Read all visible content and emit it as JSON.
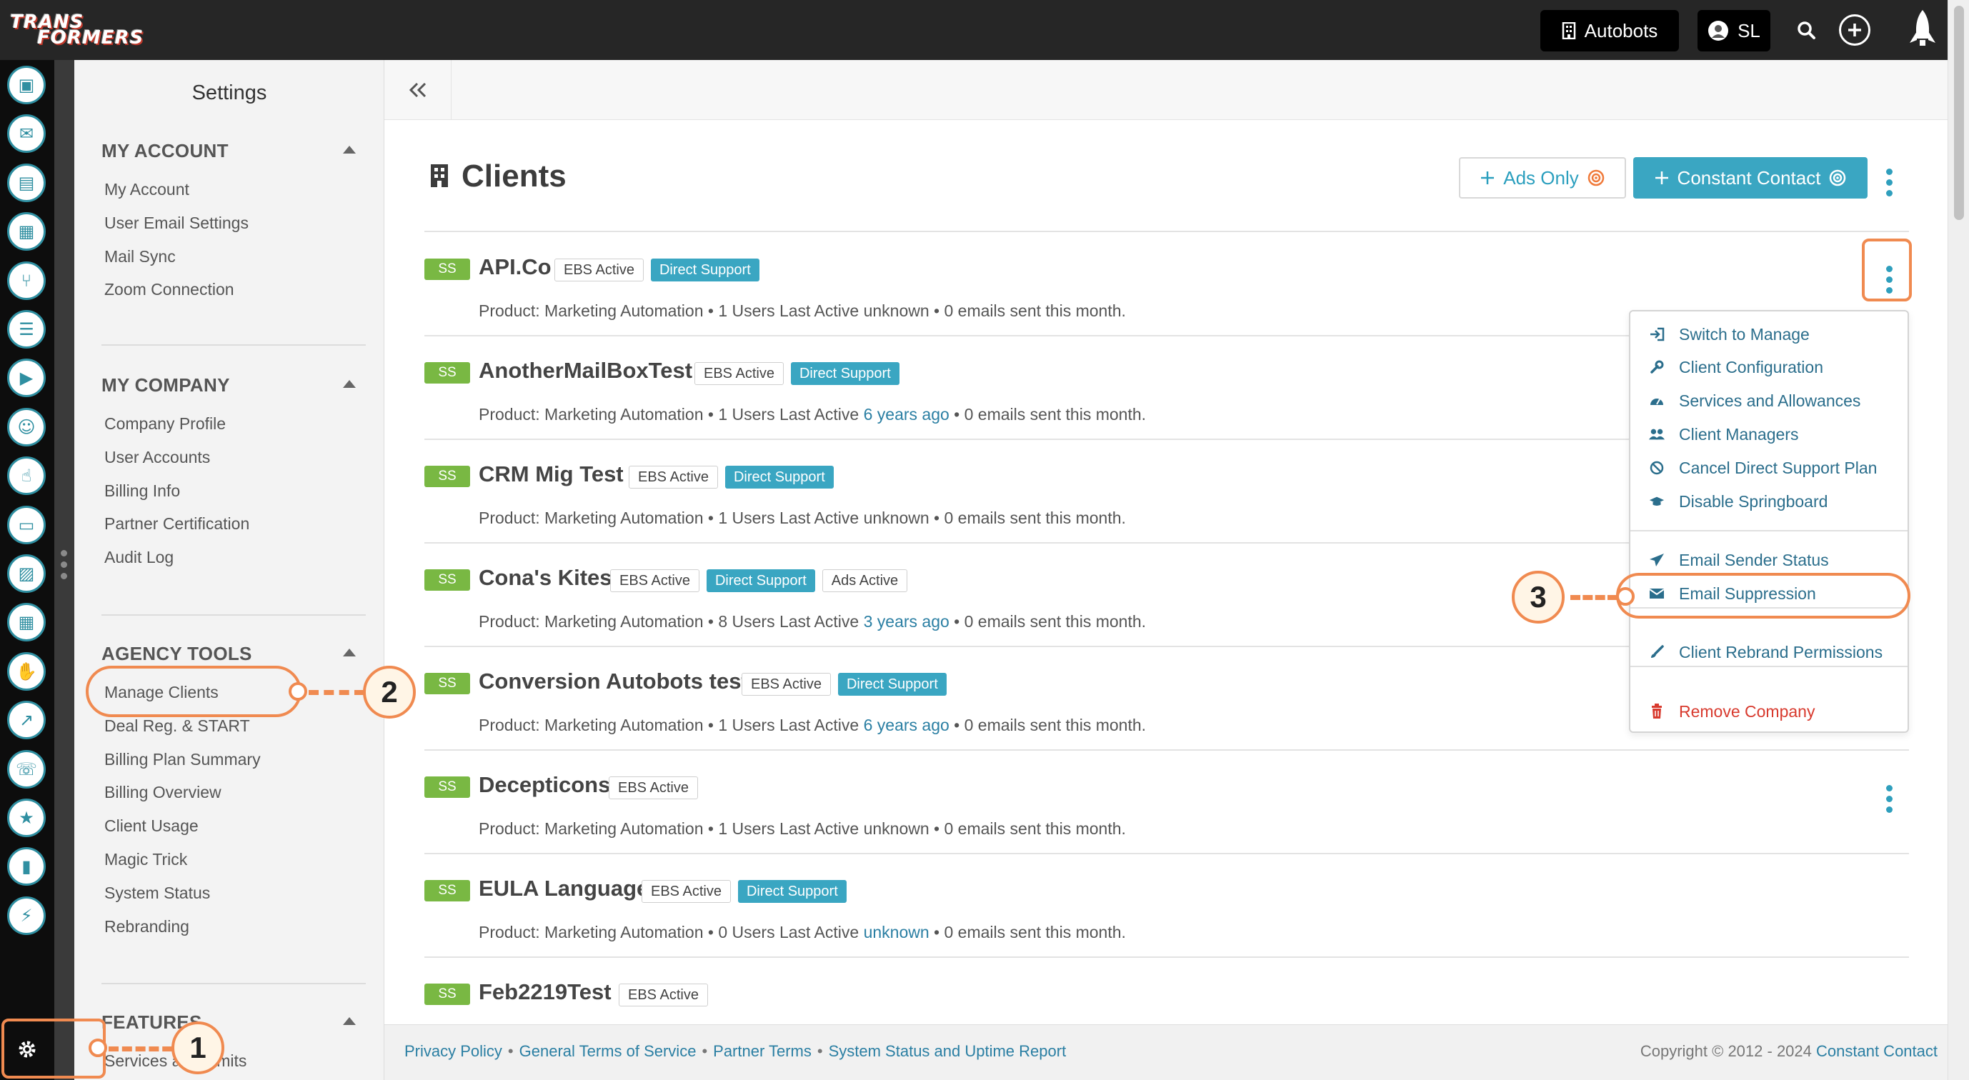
{
  "app": {
    "logo_text_line1": "TRANS",
    "logo_text_line2": "FORMERS",
    "account_label": "Autobots",
    "user_initials": "SL"
  },
  "icons": {
    "account": "building-icon",
    "user": "user-avatar-icon",
    "search": "search-icon",
    "add": "plus-icon",
    "launch": "rocket-icon",
    "collapse": "double-chevron-left-icon",
    "settings": "gear-icon"
  },
  "rail": {
    "items": [
      "contacts-icon",
      "inbox-icon",
      "clipboard-icon",
      "map-icon",
      "flow-icon",
      "list-icon",
      "megaphone-icon",
      "survey-icon",
      "thumbs-up-icon",
      "tv-icon",
      "image-icon",
      "calendar-icon",
      "handshake-icon",
      "growth-chart-icon",
      "support-icon",
      "user-star-icon",
      "bar-chart-icon",
      "plugin-icon"
    ]
  },
  "settings": {
    "title": "Settings",
    "sections": [
      {
        "heading": "MY ACCOUNT",
        "items": [
          "My Account",
          "User Email Settings",
          "Mail Sync",
          "Zoom Connection"
        ]
      },
      {
        "heading": "MY COMPANY",
        "items": [
          "Company Profile",
          "User Accounts",
          "Billing Info",
          "Partner Certification",
          "Audit Log"
        ]
      },
      {
        "heading": "AGENCY TOOLS",
        "items": [
          "Manage Clients",
          "Deal Reg. & START",
          "Billing Plan Summary",
          "Billing Overview",
          "Client Usage",
          "Magic Trick",
          "System Status",
          "Rebranding"
        ]
      },
      {
        "heading": "FEATURES",
        "items": [
          "Services and Limits"
        ]
      }
    ]
  },
  "main": {
    "title": "Clients",
    "ads_only_label": "Ads Only",
    "constant_contact_label": "Constant Contact",
    "clients": [
      {
        "badge": "SS",
        "name": "API.Co",
        "tags": [
          {
            "text": "EBS Active",
            "style": "outline"
          },
          {
            "text": "Direct Support",
            "style": "blue"
          }
        ],
        "meta_pre": "Product: Marketing Automation • 1 Users Last Active ",
        "meta_link": "",
        "meta_mid": "unknown",
        "meta_post": " • 0 emails sent this month."
      },
      {
        "badge": "SS",
        "name": "AnotherMailBoxTest",
        "tags": [
          {
            "text": "EBS Active",
            "style": "outline"
          },
          {
            "text": "Direct Support",
            "style": "blue"
          }
        ],
        "meta_pre": "Product: Marketing Automation • 1 Users Last Active ",
        "meta_link": "6 years ago",
        "meta_mid": "",
        "meta_post": " • 0 emails sent this month."
      },
      {
        "badge": "SS",
        "name": "CRM Mig Test",
        "tags": [
          {
            "text": "EBS Active",
            "style": "outline"
          },
          {
            "text": "Direct Support",
            "style": "blue"
          }
        ],
        "meta_pre": "Product: Marketing Automation • 1 Users Last Active ",
        "meta_link": "",
        "meta_mid": "unknown",
        "meta_post": " • 0 emails sent this month."
      },
      {
        "badge": "SS",
        "name": "Cona's Kites",
        "tags": [
          {
            "text": "EBS Active",
            "style": "outline"
          },
          {
            "text": "Direct Support",
            "style": "blue"
          },
          {
            "text": "Ads Active",
            "style": "outline"
          }
        ],
        "meta_pre": "Product: Marketing Automation • 8 Users Last Active ",
        "meta_link": "3 years ago",
        "meta_mid": "",
        "meta_post": " • 0 emails sent this month."
      },
      {
        "badge": "SS",
        "name": "Conversion Autobots test",
        "tags": [
          {
            "text": "EBS Active",
            "style": "outline"
          },
          {
            "text": "Direct Support",
            "style": "blue"
          }
        ],
        "meta_pre": "Product: Marketing Automation • 1 Users Last Active ",
        "meta_link": "6 years ago",
        "meta_mid": "",
        "meta_post": " • 0 emails sent this month."
      },
      {
        "badge": "SS",
        "name": "Decepticons",
        "tags": [
          {
            "text": "EBS Active",
            "style": "outline"
          }
        ],
        "meta_pre": "Product: Marketing Automation • 1 Users Last Active ",
        "meta_link": "",
        "meta_mid": "unknown",
        "meta_post": " • 0 emails sent this month."
      },
      {
        "badge": "SS",
        "name": "EULA Language",
        "tags": [
          {
            "text": "EBS Active",
            "style": "outline"
          },
          {
            "text": "Direct Support",
            "style": "blue"
          }
        ],
        "meta_pre": "Product: Marketing Automation • 0 Users Last Active ",
        "meta_link": "unknown",
        "meta_mid": "",
        "meta_post": " • 0 emails sent this month."
      },
      {
        "badge": "SS",
        "name": "Feb2219Test",
        "tags": [
          {
            "text": "EBS Active",
            "style": "outline"
          }
        ],
        "meta_pre": "",
        "meta_link": "",
        "meta_mid": "",
        "meta_post": ""
      }
    ]
  },
  "menu": {
    "groups": [
      [
        {
          "label": "Switch to Manage",
          "icon": "sign-in-icon"
        },
        {
          "label": "Client Configuration",
          "icon": "wrench-icon"
        },
        {
          "label": "Services and Allowances",
          "icon": "gauge-icon"
        },
        {
          "label": "Client Managers",
          "icon": "users-icon"
        },
        {
          "label": "Cancel Direct Support Plan",
          "icon": "ban-icon"
        },
        {
          "label": "Disable Springboard",
          "icon": "graduation-cap-icon"
        }
      ],
      [
        {
          "label": "Email Sender Status",
          "icon": "paper-plane-icon"
        },
        {
          "label": "Email Suppression",
          "icon": "envelope-icon"
        }
      ],
      [
        {
          "label": "Client Rebrand Permissions",
          "icon": "brush-icon"
        }
      ],
      [
        {
          "label": "Remove Company",
          "icon": "trash-icon"
        }
      ]
    ]
  },
  "callouts": {
    "one": "1",
    "two": "2",
    "three": "3"
  },
  "footer": {
    "links": [
      "Privacy Policy",
      "General Terms of Service",
      "Partner Terms",
      "System Status and Uptime Report"
    ],
    "copyright": "Copyright © 2012 - 2024",
    "copyright_link": "Constant Contact"
  },
  "colors": {
    "accent": "#3aa6c2",
    "ss_badge": "#79b843",
    "callout": "#f08a50",
    "danger": "#d83a2e",
    "link": "#2b7fa3"
  }
}
